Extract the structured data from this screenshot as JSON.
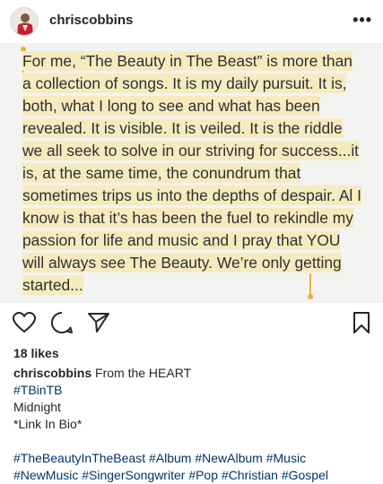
{
  "header": {
    "username": "chriscobbins",
    "more_label": "•••"
  },
  "note": {
    "text": "For me, “The Beauty in The Beast” is more than a collection of songs. It is my daily pursuit. It is, both, what I long to see and what has been revealed. It is visible. It is veiled. It is the riddle we all seek to solve in our striving for success...it is, at the same time, the conundrum that sometimes trips us into the depths of despair. Al I know is that it’s has been the fuel to rekindle my passion for life and music and I pray that YOU will always see The Beauty. We’re only getting started..."
  },
  "actions": {
    "like_icon": "heart-icon",
    "comment_icon": "comment-icon",
    "share_icon": "send-icon",
    "save_icon": "bookmark-icon"
  },
  "likes_label": "18 likes",
  "caption": {
    "username": "chriscobbins",
    "text": "From the HEART",
    "tag_line": "#TBinTB",
    "line2": "Midnight",
    "line3": "*Link In Bio*",
    "hashtags_row1": [
      "#TheBeautyInTheBeast",
      "#Album",
      "#NewAlbum",
      "#Music"
    ],
    "hashtags_row2": [
      "#NewMusic",
      "#SingerSongwriter",
      "#Pop",
      "#Christian",
      "#Gospel"
    ]
  }
}
